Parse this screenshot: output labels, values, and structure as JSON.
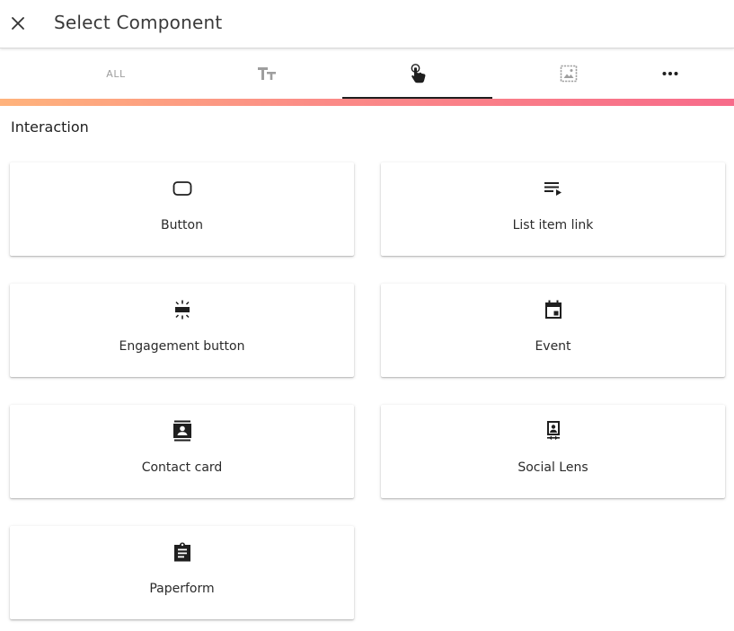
{
  "header": {
    "title": "Select Component",
    "close_icon": "close-icon"
  },
  "tabs": [
    {
      "label": "ALL",
      "icon": "",
      "active": false
    },
    {
      "label": "",
      "icon": "text-format-icon",
      "active": false
    },
    {
      "label": "",
      "icon": "touch-icon",
      "active": true
    },
    {
      "label": "",
      "icon": "image-icon",
      "active": false
    },
    {
      "label": "",
      "icon": "more-horizontal-icon",
      "active": false
    }
  ],
  "section": {
    "title": "Interaction"
  },
  "components": [
    {
      "label": "Button",
      "icon": "button-icon"
    },
    {
      "label": "List item link",
      "icon": "playlist-play-icon"
    },
    {
      "label": "Engagement button",
      "icon": "engagement-icon"
    },
    {
      "label": "Event",
      "icon": "event-calendar-icon"
    },
    {
      "label": "Contact card",
      "icon": "contacts-icon"
    },
    {
      "label": "Social Lens",
      "icon": "social-lens-icon"
    },
    {
      "label": "Paperform",
      "icon": "assignment-icon"
    }
  ],
  "colors": {
    "gradient_start": "#ffb37c",
    "gradient_end": "#f76b8a",
    "active_tab_indicator": "#1f1f1f",
    "inactive_icon": "#9e9e9e"
  }
}
